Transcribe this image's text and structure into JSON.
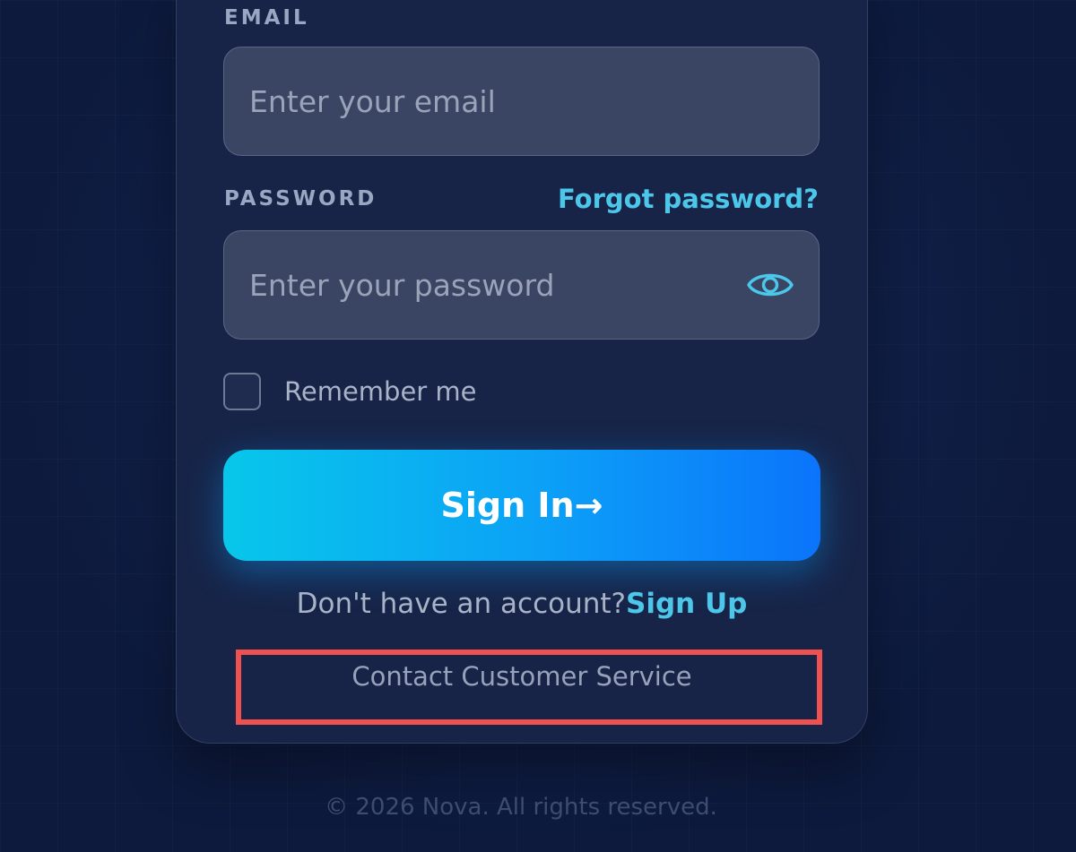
{
  "form": {
    "email_label": "EMAIL",
    "email_placeholder": "Enter your email",
    "email_value": "",
    "password_label": "PASSWORD",
    "forgot_password": "Forgot password?",
    "password_placeholder": "Enter your password",
    "password_value": "",
    "password_visibility_icon": "eye-icon",
    "remember_me": "Remember me",
    "remember_me_checked": false,
    "sign_in_button": "Sign In→",
    "no_account_text": "Don't have an account?",
    "sign_up_link": "Sign Up",
    "contact_link": "Contact Customer Service"
  },
  "highlight": {
    "color": "#ef5050"
  },
  "footer": {
    "copyright": "© 2026 Nova. All rights reserved."
  },
  "colors": {
    "background": "#0d1a3d",
    "card": "#172448",
    "input": "#394563",
    "accent": "#4cc7ea",
    "button_gradient_start": "#08c7ea",
    "button_gradient_end": "#0b74fb"
  }
}
